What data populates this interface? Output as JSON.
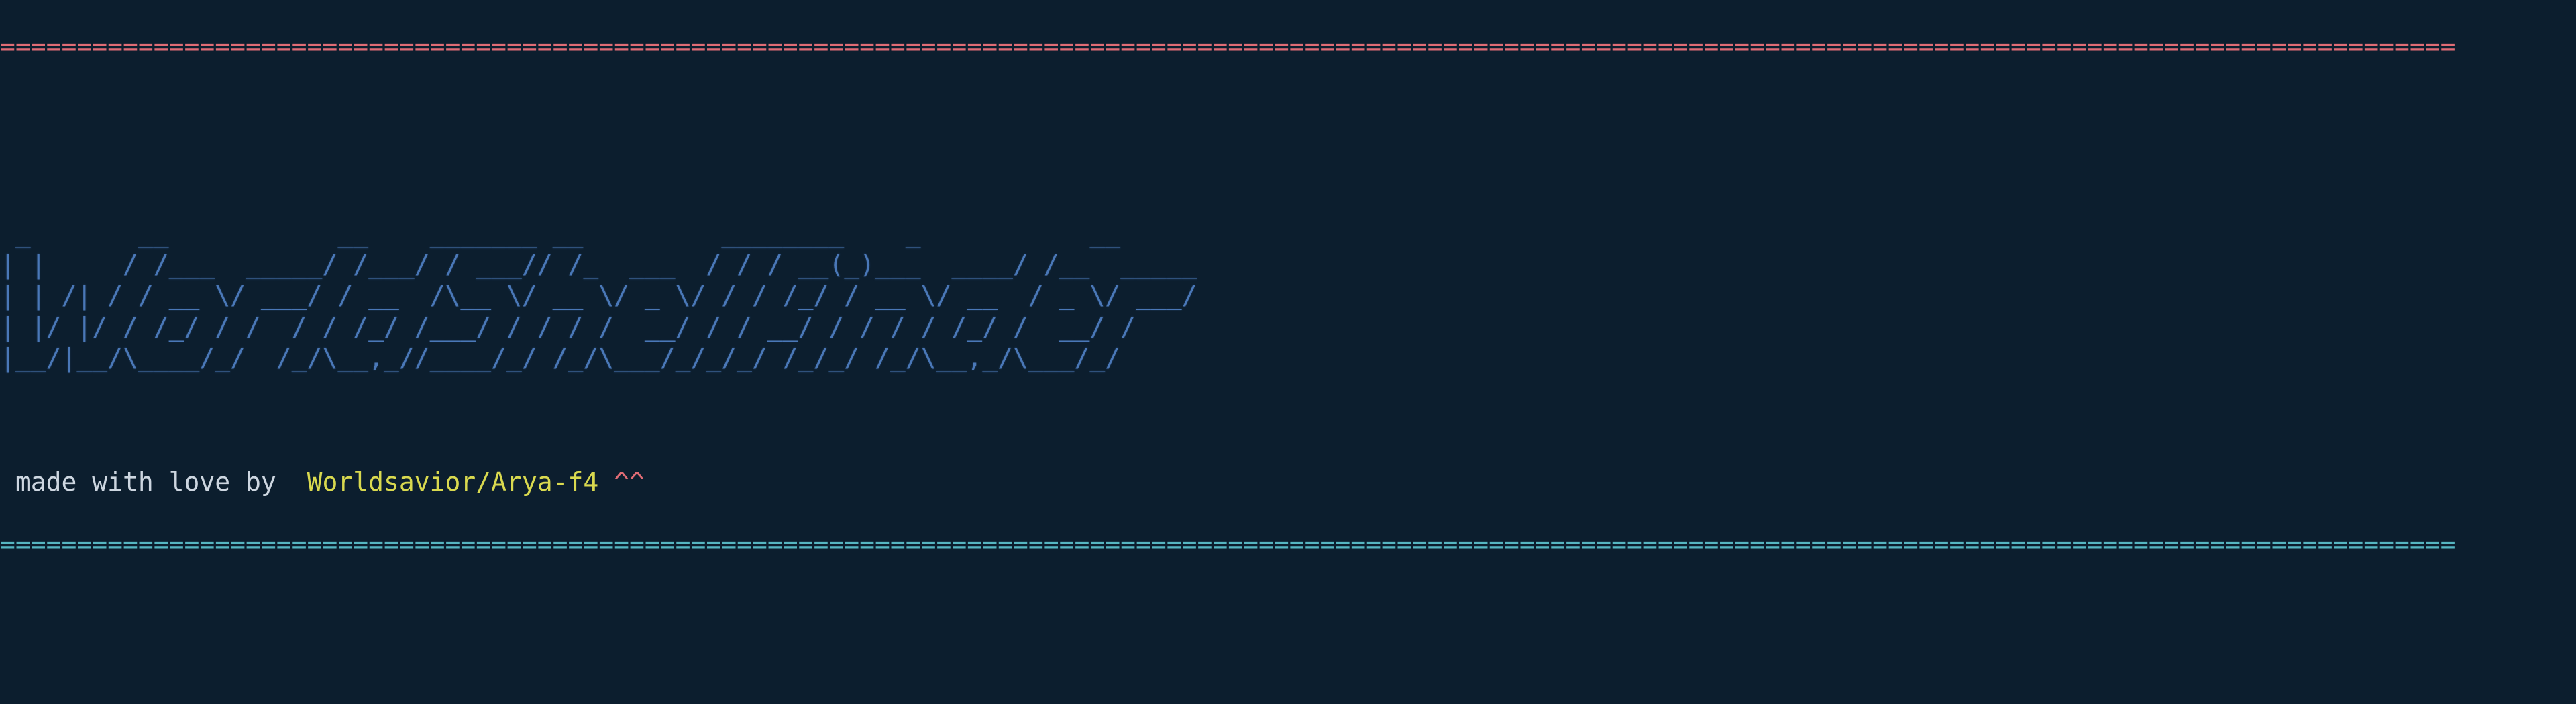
{
  "banner": {
    "top_rule": "================================================================================================================================================================",
    "bottom_rule": "================================================================================================================================================================",
    "ascii_art": " _       __           __    _______ __         ________    _           __\n| |     / /___  _____/ /___/ / ___// /_  ___  / / / __(_)___  ____/ /__  _____\n| | /| / / __ \\/ ___/ / __  /\\__ \\/ __ \\/ _ \\/ / / /_/ / __ \\/ __  / _ \\/ ___/\n| |/ |/ / /_/ / /  / / /_/ /___/ / / / /  __/ / / __/ / / / / /_/ /  __/ /\n|__/|__/\\____/_/  /_/\\__,_//____/_/ /_/\\___/_/_/_/ /_/_/ /_/\\__,_/\\___/_/",
    "credit_prefix": " made with love by  ",
    "credit_name": "Worldsavior/Arya-f4 ",
    "credit_suffix": "^^"
  }
}
